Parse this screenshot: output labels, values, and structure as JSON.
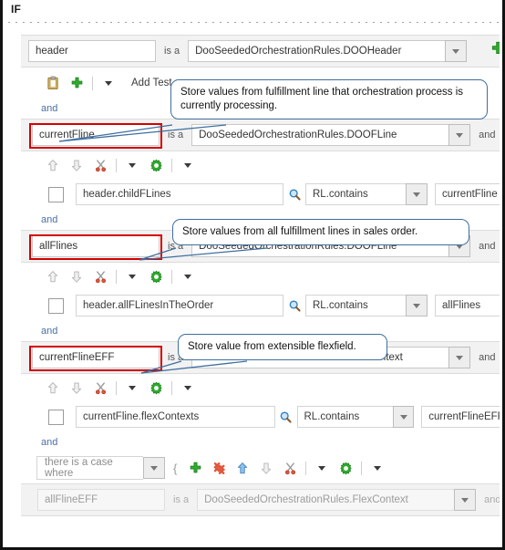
{
  "window": {
    "section_label": "IF"
  },
  "labels": {
    "is_a": "is a",
    "and": "and",
    "and_connector": "and",
    "add_test": "Add Test",
    "open_brace": "{"
  },
  "header_row": {
    "variable": "header",
    "is_a": "is a",
    "type": "DooSeededOrchestrationRules.DOOHeader",
    "highlighted": false,
    "add_icon": "plus-icon"
  },
  "header_toolbar": {
    "items": [
      {
        "icon": "clipboard-icon",
        "name": "paste-button"
      },
      {
        "icon": "plus-icon",
        "name": "add-button"
      },
      {
        "icon": "caret-down-icon",
        "name": "add-menu-button"
      }
    ],
    "add_test_label": "Add Test"
  },
  "blocks": [
    {
      "pattern": {
        "variable": "currentFline",
        "is_a": "is a",
        "type": "DooSeededOrchestrationRules.DOOFLine",
        "trailing": "and",
        "highlighted": true
      },
      "toolbar": [
        {
          "icon": "arrow-up-icon",
          "name": "move-up-button",
          "enabled": false
        },
        {
          "icon": "arrow-down-icon",
          "name": "move-down-button",
          "enabled": false
        },
        {
          "icon": "scissors-icon",
          "name": "cut-button",
          "enabled": true
        },
        {
          "icon": "caret-down-icon",
          "name": "cut-menu-button",
          "enabled": true
        },
        {
          "icon": "gear-icon",
          "name": "settings-button",
          "enabled": true
        },
        {
          "icon": "caret-down-icon",
          "name": "settings-menu-button",
          "enabled": true
        }
      ],
      "condition": {
        "checked": false,
        "left": "header.childFLines",
        "search_icon": "magnifier-icon",
        "operator": "RL.contains",
        "right": "currentFline"
      },
      "connector": "and"
    },
    {
      "pattern": {
        "variable": "allFlines",
        "is_a": "is a",
        "type": "DooSeededOrchestrationRules.DOOFLine",
        "trailing": "and",
        "highlighted": true
      },
      "toolbar": [
        {
          "icon": "arrow-up-icon",
          "name": "move-up-button",
          "enabled": false
        },
        {
          "icon": "arrow-down-icon",
          "name": "move-down-button",
          "enabled": false
        },
        {
          "icon": "scissors-icon",
          "name": "cut-button",
          "enabled": true
        },
        {
          "icon": "caret-down-icon",
          "name": "cut-menu-button",
          "enabled": true
        },
        {
          "icon": "gear-icon",
          "name": "settings-button",
          "enabled": true
        },
        {
          "icon": "caret-down-icon",
          "name": "settings-menu-button",
          "enabled": true
        }
      ],
      "condition": {
        "checked": false,
        "left": "header.allFLinesInTheOrder",
        "search_icon": "magnifier-icon",
        "operator": "RL.contains",
        "right": "allFlines"
      },
      "connector": "and"
    },
    {
      "pattern": {
        "variable": "currentFlineEFF",
        "is_a": "is a",
        "type": "DooSeededOrchestrationRules.FlexContext",
        "trailing": "and",
        "highlighted": true
      },
      "toolbar": [
        {
          "icon": "arrow-up-icon",
          "name": "move-up-button",
          "enabled": false
        },
        {
          "icon": "arrow-down-icon",
          "name": "move-down-button",
          "enabled": false
        },
        {
          "icon": "scissors-icon",
          "name": "cut-button",
          "enabled": true
        },
        {
          "icon": "caret-down-icon",
          "name": "cut-menu-button",
          "enabled": true
        },
        {
          "icon": "gear-icon",
          "name": "settings-button",
          "enabled": true
        },
        {
          "icon": "caret-down-icon",
          "name": "settings-menu-button",
          "enabled": true
        }
      ],
      "condition": {
        "checked": false,
        "left": "currentFline.flexContexts",
        "search_icon": "magnifier-icon",
        "operator": "RL.contains",
        "right": "currentFlineEFF"
      },
      "connector": "and"
    }
  ],
  "case_row": {
    "selected": "there is a case where",
    "brace": "{",
    "toolbar": [
      {
        "icon": "plus-icon",
        "name": "add-button",
        "enabled": true
      },
      {
        "icon": "delete-icon",
        "name": "delete-button",
        "enabled": true
      },
      {
        "icon": "arrow-up-icon",
        "name": "move-up-button",
        "enabled": true
      },
      {
        "icon": "arrow-down-icon",
        "name": "move-down-button",
        "enabled": false
      },
      {
        "icon": "scissors-icon",
        "name": "cut-button",
        "enabled": true
      },
      {
        "icon": "caret-down-icon",
        "name": "cut-menu-button",
        "enabled": true
      },
      {
        "icon": "gear-icon",
        "name": "settings-button",
        "enabled": true
      },
      {
        "icon": "caret-down-icon",
        "name": "settings-menu-button",
        "enabled": true
      }
    ]
  },
  "last_row": {
    "variable": "allFlineEFF",
    "is_a": "is a",
    "type": "DooSeededOrchestrationRules.FlexContext",
    "trailing": "and",
    "faded": true
  },
  "callouts": [
    {
      "text": "Store values from fulfillment line that orchestration process is currently processing."
    },
    {
      "text": "Store values from all fulfillment lines in sales order."
    },
    {
      "text": "Store value from extensible flexfield."
    }
  ],
  "colors": {
    "callout_border": "#3f6f9f",
    "highlight_red": "#d40000",
    "connector_blue": "#4a6fa5",
    "green_icon": "#2eab2e",
    "red_icon": "#e0563c",
    "blue_icon": "#6aa9e0"
  }
}
